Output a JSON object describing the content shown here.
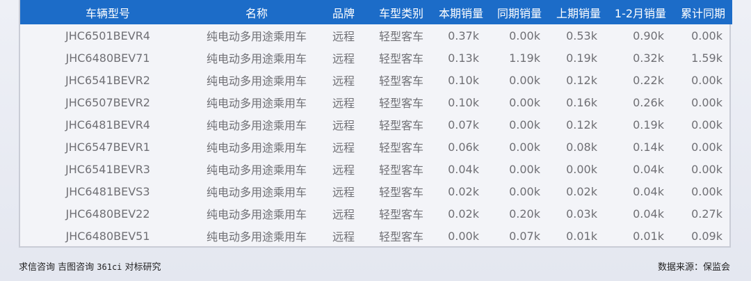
{
  "table": {
    "headers": [
      "车辆型号",
      "名称",
      "品牌",
      "车型类别",
      "本期销量",
      "同期销量",
      "上期销量",
      "1-2月销量",
      "累计同期"
    ],
    "rows": [
      [
        "JHC6501BEVR4",
        "纯电动多用途乘用车",
        "远程",
        "轻型客车",
        "0.37k",
        "0.00k",
        "0.53k",
        "0.90k",
        "0.00k"
      ],
      [
        "JHC6480BEV71",
        "纯电动多用途乘用车",
        "远程",
        "轻型客车",
        "0.13k",
        "1.19k",
        "0.19k",
        "0.32k",
        "1.59k"
      ],
      [
        "JHC6541BEVR2",
        "纯电动多用途乘用车",
        "远程",
        "轻型客车",
        "0.10k",
        "0.00k",
        "0.12k",
        "0.22k",
        "0.00k"
      ],
      [
        "JHC6507BEVR2",
        "纯电动多用途乘用车",
        "远程",
        "轻型客车",
        "0.10k",
        "0.00k",
        "0.16k",
        "0.26k",
        "0.00k"
      ],
      [
        "JHC6481BEVR4",
        "纯电动多用途乘用车",
        "远程",
        "轻型客车",
        "0.07k",
        "0.00k",
        "0.12k",
        "0.19k",
        "0.00k"
      ],
      [
        "JHC6547BEVR1",
        "纯电动多用途乘用车",
        "远程",
        "轻型客车",
        "0.06k",
        "0.00k",
        "0.08k",
        "0.14k",
        "0.00k"
      ],
      [
        "JHC6541BEVR3",
        "纯电动多用途乘用车",
        "远程",
        "轻型客车",
        "0.04k",
        "0.00k",
        "0.00k",
        "0.04k",
        "0.00k"
      ],
      [
        "JHC6481BEVS3",
        "纯电动多用途乘用车",
        "远程",
        "轻型客车",
        "0.02k",
        "0.00k",
        "0.02k",
        "0.04k",
        "0.00k"
      ],
      [
        "JHC6480BEV22",
        "纯电动多用途乘用车",
        "远程",
        "轻型客车",
        "0.02k",
        "0.20k",
        "0.03k",
        "0.04k",
        "0.27k"
      ],
      [
        "JHC6480BEV51",
        "纯电动多用途乘用车",
        "远程",
        "轻型客车",
        "0.00k",
        "0.07k",
        "0.01k",
        "0.01k",
        "0.09k"
      ]
    ]
  },
  "footer": {
    "left_part1": "求信咨询 吉图咨询 ",
    "left_code": "361ci",
    "left_part2": " 对标研究",
    "right": "数据来源：保监会"
  },
  "colors": {
    "header_bg": "#1c6cc8",
    "header_text": "#ffffff",
    "cell_text": "#6f6f74"
  }
}
